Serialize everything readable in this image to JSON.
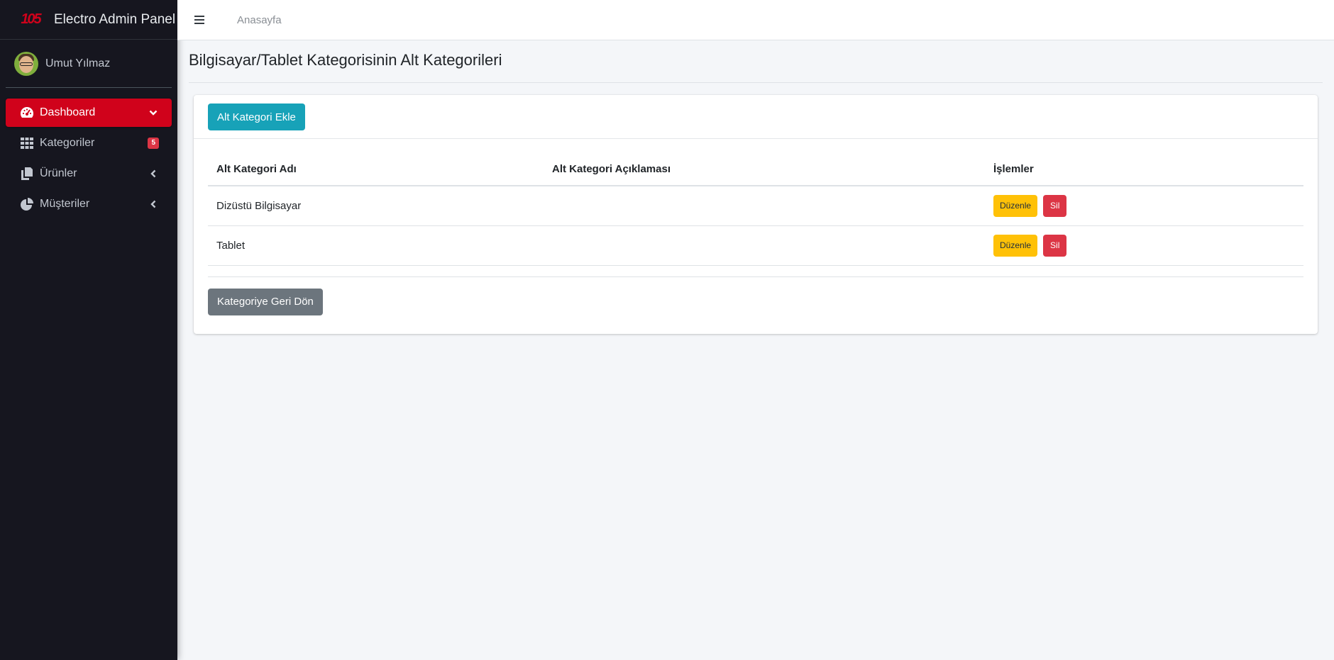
{
  "brand": {
    "logo_text": "105",
    "title": "Electro Admin Panel"
  },
  "user": {
    "name": "Umut Yılmaz"
  },
  "sidebar": {
    "items": [
      {
        "label": "Dashboard",
        "icon": "tachometer-icon",
        "right": "chevron-down-icon",
        "active": true
      },
      {
        "label": "Kategoriler",
        "icon": "th-icon",
        "badge": "5"
      },
      {
        "label": "Ürünler",
        "icon": "copy-icon",
        "right": "chevron-left-icon"
      },
      {
        "label": "Müşteriler",
        "icon": "chart-pie-icon",
        "right": "chevron-left-icon"
      }
    ]
  },
  "topbar": {
    "menu_icon": "bars-icon",
    "home_link": "Anasayfa"
  },
  "page": {
    "title": "Bilgisayar/Tablet Kategorisinin Alt Kategorileri"
  },
  "actions": {
    "add_label": "Alt Kategori Ekle",
    "back_label": "Kategoriye Geri Dön"
  },
  "table": {
    "headers": [
      "Alt Kategori Adı",
      "Alt Kategori Açıklaması",
      "İşlemler"
    ],
    "rows": [
      {
        "name": "Dizüstü Bilgisayar",
        "description": "",
        "edit_label": "Düzenle",
        "delete_label": "Sil"
      },
      {
        "name": "Tablet",
        "description": "",
        "edit_label": "Düzenle",
        "delete_label": "Sil"
      }
    ]
  },
  "colors": {
    "sidebar_bg": "#16161f",
    "active": "#d0021b",
    "info": "#17a2b8",
    "warning": "#ffc107",
    "danger": "#dc3545",
    "secondary": "#6c757d"
  }
}
